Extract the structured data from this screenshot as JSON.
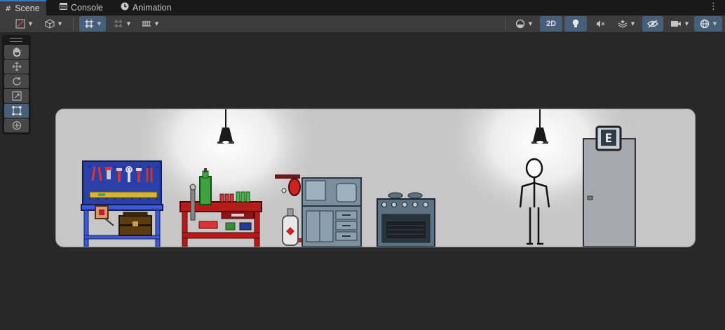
{
  "tabs": [
    {
      "label": "Scene",
      "icon": "grid-icon",
      "active": true
    },
    {
      "label": "Console",
      "icon": "console-icon",
      "active": false
    },
    {
      "label": "Animation",
      "icon": "animation-clock-icon",
      "active": false
    }
  ],
  "toolbar": {
    "mode_2d_label": "2D",
    "active_color": "#46607c"
  },
  "tools": [
    {
      "name": "hand-tool",
      "icon": "hand-icon",
      "active": false
    },
    {
      "name": "move-tool",
      "icon": "move-arrows-icon",
      "active": false
    },
    {
      "name": "rotate-tool",
      "icon": "rotate-icon",
      "active": false
    },
    {
      "name": "scale-tool",
      "icon": "scale-icon",
      "active": false
    },
    {
      "name": "rect-tool",
      "icon": "rect-transform-icon",
      "active": true
    },
    {
      "name": "transform-tool",
      "icon": "transform-icon",
      "active": false
    }
  ],
  "scene": {
    "background_color": "#c6c6c6",
    "door_key_label": "E"
  }
}
